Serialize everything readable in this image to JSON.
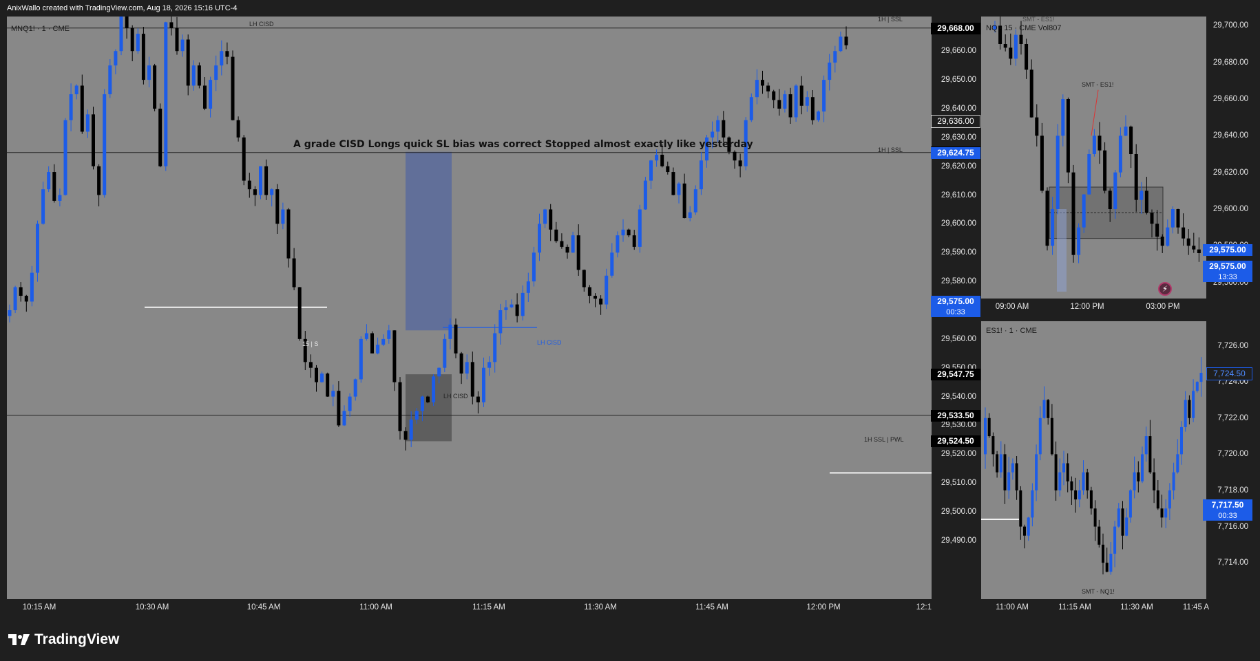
{
  "header": {
    "attribution": "AnixWallo created with TradingView.com, Aug 18, 2026 15:16 UTC-4"
  },
  "footer": {
    "brand": "TradingView",
    "logo_icon": "tradingview-logo-icon"
  },
  "colors": {
    "bull": "#1c5ce8",
    "bear": "#000000",
    "panel_bg": "#888888",
    "frame": "#1f1f1f"
  },
  "main": {
    "symbol_label": "MNQ1! · 1 · CME",
    "note": "A grade CISD Longs quick SL bias was correct Stopped almost exactly like yesterday",
    "annotations": {
      "top_cisd": "LH CISD",
      "blue_cisd": "LH CISD",
      "box_cisd": "LH CISD",
      "level_15": "15 | S",
      "ssl_top": "1H | SSL",
      "ssl_mid": "1H | SSL",
      "ssl_pwl": "1H SSL | PWL"
    },
    "badges": [
      {
        "value": "29,668.00",
        "style": "dark"
      },
      {
        "value": "29,636.00",
        "style": "outline"
      },
      {
        "value": "29,625.00",
        "style": "dark"
      },
      {
        "value": "29,624.75",
        "style": "blue"
      },
      {
        "value": "29,575.00",
        "sub": "00:33",
        "style": "blue"
      },
      {
        "value": "29,547.75",
        "style": "dark"
      },
      {
        "value": "29,533.50",
        "style": "dark"
      },
      {
        "value": "29,524.50",
        "style": "dark"
      }
    ]
  },
  "top_right": {
    "symbol_label": "NQ · 15 · CME  Vol807",
    "annotations": {
      "smt_top": "SMT - ES1!",
      "smt_mid": "SMT - ES1!"
    },
    "badges": [
      {
        "value": "29,575.00",
        "style": "blue"
      },
      {
        "value": "29,575.00",
        "sub": "13:33",
        "style": "blue"
      }
    ]
  },
  "bottom_right": {
    "symbol_label": "ES1! · 1 · CME",
    "annotations": {
      "smt_bottom": "SMT - NQ1!"
    },
    "badges": [
      {
        "value": "7,724.50",
        "style": "blue-outline"
      },
      {
        "value": "7,717.50",
        "sub": "00:33",
        "style": "blue"
      }
    ]
  },
  "chart_data": [
    {
      "type": "candlestick",
      "symbol": "MNQ1!",
      "timeframe": "1",
      "y_ticks": [
        "29,660.00",
        "29,650.00",
        "29,640.00",
        "29,630.00",
        "29,620.00",
        "29,610.00",
        "29,600.00",
        "29,590.00",
        "29,580.00",
        "29,570.00",
        "29,560.00",
        "29,550.00",
        "29,540.00",
        "29,530.00",
        "29,520.00",
        "29,510.00",
        "29,500.00",
        "29,490.00"
      ],
      "x_ticks": [
        "10:15 AM",
        "10:30 AM",
        "10:45 AM",
        "11:00 AM",
        "11:15 AM",
        "11:30 AM",
        "11:45 AM",
        "12:00 PM",
        "12:1"
      ],
      "ylim": [
        29484,
        29672
      ],
      "levels": [
        29668.0,
        29624.75,
        29533.5,
        29571.0,
        29513.5,
        29564.0
      ],
      "zones": [
        {
          "name": "long position",
          "from": 29625,
          "to": 29563
        },
        {
          "name": "stop zone",
          "from": 29547.75,
          "to": 29524.5
        }
      ],
      "closes": [
        29570,
        29578,
        29575,
        29573,
        29583,
        29600,
        29612,
        29618,
        29608,
        29610,
        29636,
        29645,
        29648,
        29632,
        29638,
        29620,
        29610,
        29645,
        29655,
        29660,
        29672,
        29668,
        29660,
        29666,
        29650,
        29655,
        29640,
        29620,
        29670,
        29668,
        29660,
        29664,
        29648,
        29655,
        29648,
        29640,
        29650,
        29655,
        29660,
        29658,
        29636,
        29630,
        29615,
        29612,
        29610,
        29620,
        29610,
        29612,
        29600,
        29605,
        29588,
        29578,
        29560,
        29552,
        29550,
        29545,
        29548,
        29540,
        29542,
        29530,
        29535,
        29540,
        29546,
        29560,
        29562,
        29555,
        29558,
        29560,
        29563,
        29545,
        29528,
        29525,
        29532,
        29535,
        29540,
        29538,
        29547,
        29550,
        29560,
        29565,
        29555,
        29548,
        29552,
        29540,
        29538,
        29550,
        29552,
        29562,
        29570,
        29571,
        29572,
        29568,
        29576,
        29580,
        29590,
        29600,
        29605,
        29598,
        29594,
        29592,
        29590,
        29596,
        29584,
        29578,
        29575,
        29574,
        29572,
        29582,
        29590,
        29596,
        29598,
        29596,
        29592,
        29605,
        29615,
        29622,
        29624,
        29620,
        29618,
        29610,
        29614,
        29602,
        29604,
        29612,
        29622,
        29630,
        29632,
        29636,
        29630,
        29625,
        29622,
        29620,
        29636,
        29644,
        29650,
        29648,
        29646,
        29643,
        29640,
        29645,
        29637,
        29648,
        29641,
        29644,
        29636,
        29639,
        29650,
        29656,
        29660,
        29665,
        29662
      ]
    },
    {
      "type": "candlestick",
      "symbol": "NQ",
      "timeframe": "15",
      "y_ticks": [
        "29,700.00",
        "29,680.00",
        "29,660.00",
        "29,640.00",
        "29,620.00",
        "29,600.00",
        "29,580.00",
        "29,560.00"
      ],
      "x_ticks": [
        "09:00 AM",
        "12:00 PM",
        "03:00 PM"
      ],
      "ylim": [
        29555,
        29705
      ]
    },
    {
      "type": "candlestick",
      "symbol": "ES1!",
      "timeframe": "1",
      "y_ticks": [
        "7,726.00",
        "7,724.00",
        "7,722.00",
        "7,720.00",
        "7,718.00",
        "7,716.00",
        "7,714.00"
      ],
      "x_ticks": [
        "11:00 AM",
        "11:15 AM",
        "11:30 AM",
        "11:45 A"
      ],
      "ylim": [
        7712.6,
        7727.2
      ]
    }
  ]
}
